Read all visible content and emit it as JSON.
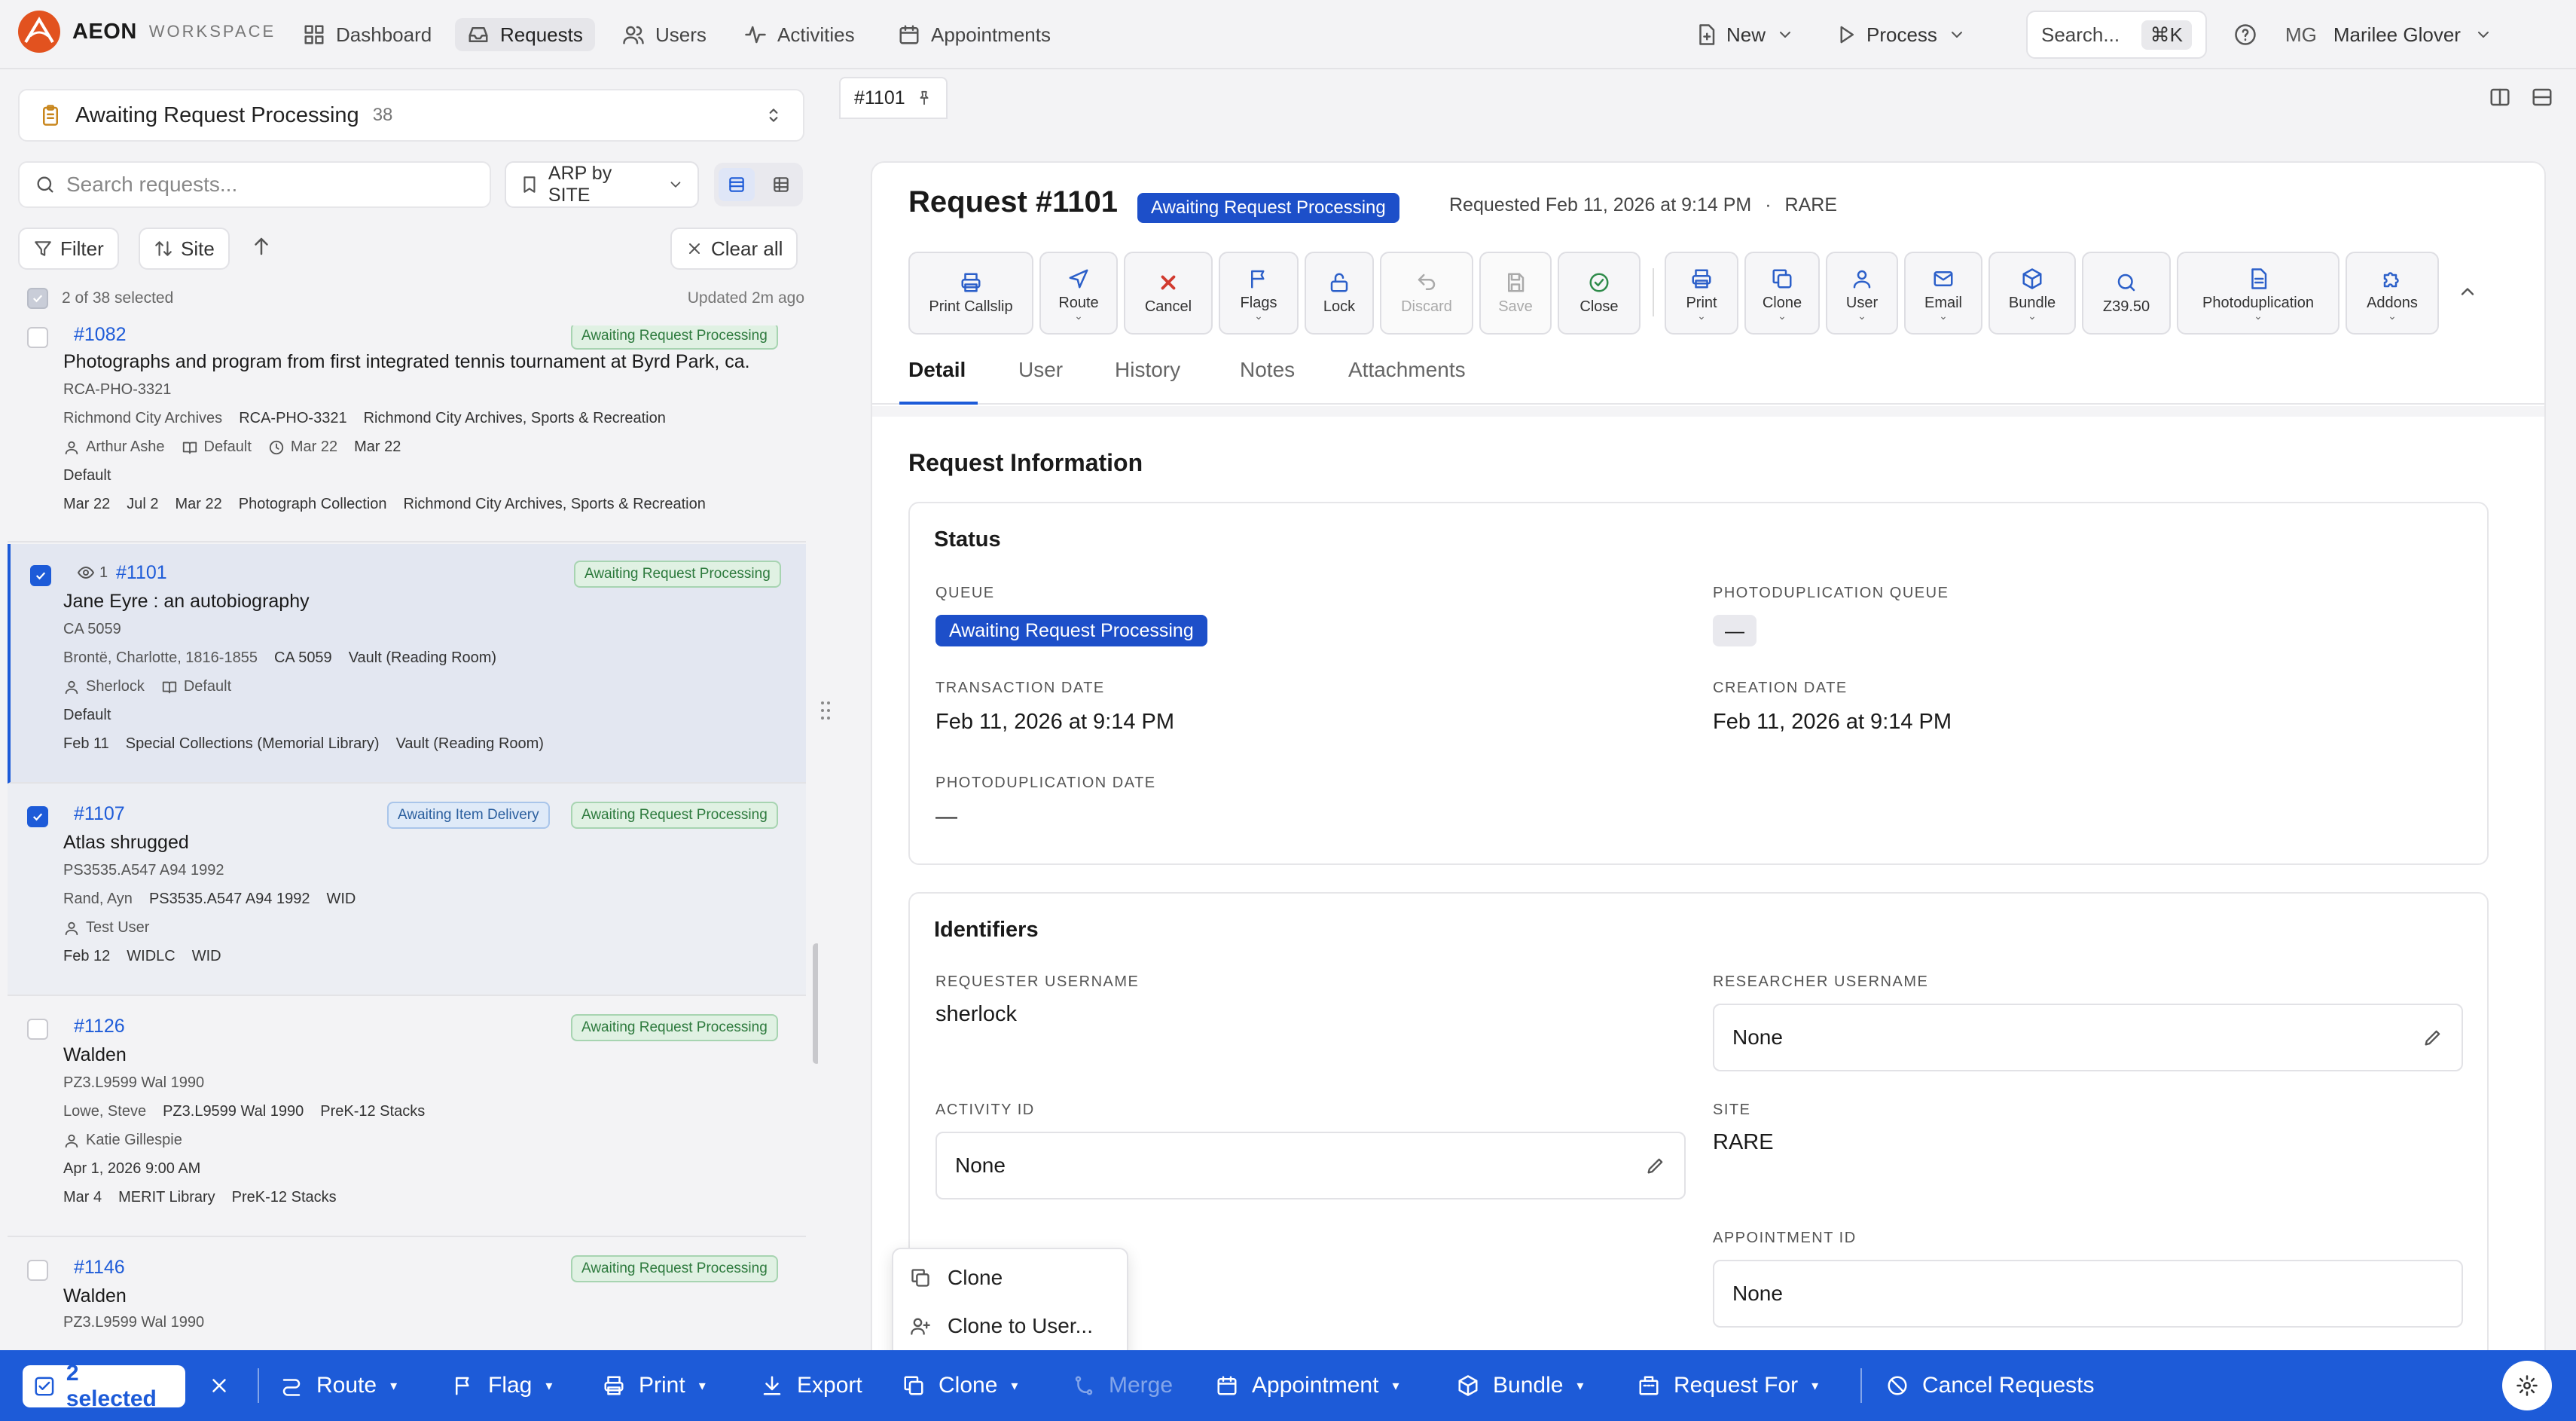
{
  "app": {
    "name": "AEON",
    "sub": "WORKSPACE",
    "accent": "#1d5bd8"
  },
  "nav": [
    {
      "label": "Dashboard",
      "icon": "dashboard-icon"
    },
    {
      "label": "Requests",
      "icon": "inbox-icon"
    },
    {
      "label": "Users",
      "icon": "users-icon"
    },
    {
      "label": "Activities",
      "icon": "activity-icon"
    },
    {
      "label": "Appointments",
      "icon": "calendar-icon"
    }
  ],
  "top": {
    "new": "New",
    "process": "Process",
    "search": "Search...",
    "kbd": "⌘K",
    "initials": "MG",
    "user": "Marilee Glover"
  },
  "left": {
    "queue": "Awaiting Request Processing",
    "queue_count": "38",
    "search_placeholder": "Search requests...",
    "saved": "ARP by SITE",
    "filter": "Filter",
    "sort": "Site",
    "clear": "Clear all",
    "selected": "2 of 38 selected",
    "updated": "Updated 2m ago"
  },
  "cards": [
    {
      "id": "#1082",
      "badges": [
        "Awaiting Request Processing"
      ],
      "title": "Photographs and program from first integrated tennis tournament at Byrd Park, ca.",
      "l1": "RCA-PHO-3321",
      "l2": [
        "Richmond City Archives",
        "RCA-PHO-3321",
        "Richmond City Archives, Sports & Recreation"
      ],
      "user": "Arthur Ashe",
      "book": "Default",
      "clock": "Mar 22",
      "extra": "Mar 22",
      "l4": "Default",
      "l5": [
        "Mar 22",
        "Jul 2",
        "Mar 22",
        "Photograph Collection",
        "Richmond City Archives, Sports & Recreation"
      ]
    },
    {
      "id": "#1101",
      "views": "1",
      "badges": [
        "Awaiting Request Processing"
      ],
      "title": "Jane Eyre : an autobiography",
      "l1": "CA 5059",
      "l2": [
        "Brontë, Charlotte, 1816-1855",
        "CA 5059",
        "Vault (Reading Room)"
      ],
      "user": "Sherlock",
      "book": "Default",
      "l4": "Default",
      "l5": [
        "Feb 11",
        "Special Collections (Memorial Library)",
        "Vault (Reading Room)"
      ]
    },
    {
      "id": "#1107",
      "badges": [
        "Awaiting Item Delivery",
        "Awaiting Request Processing"
      ],
      "title": "Atlas shrugged",
      "l1": "PS3535.A547 A94 1992",
      "l2": [
        "Rand, Ayn",
        "PS3535.A547 A94 1992",
        "WID"
      ],
      "user": "Test User",
      "l5": [
        "Feb 12",
        "WIDLC",
        "WID"
      ]
    },
    {
      "id": "#1126",
      "badges": [
        "Awaiting Request Processing"
      ],
      "title": "Walden",
      "l1": "PZ3.L9599 Wal 1990",
      "l2": [
        "Lowe, Steve",
        "PZ3.L9599 Wal 1990",
        "PreK-12 Stacks"
      ],
      "user": "Katie Gillespie",
      "l4": "Apr 1, 2026 9:00 AM",
      "l5": [
        "Mar 4",
        "MERIT Library",
        "PreK-12 Stacks"
      ]
    },
    {
      "id": "#1146",
      "badges": [
        "Awaiting Request Processing"
      ],
      "title": "Walden",
      "l1": "PZ3.L9599 Wal 1990"
    }
  ],
  "detail": {
    "tab": "#1101",
    "title": "Request #1101",
    "status": "Awaiting Request Processing",
    "meta": "Requested Feb 11, 2026 at 9:14 PM",
    "dot": "·",
    "site_meta": "RARE",
    "toolbar": [
      "Print Callslip",
      "Route",
      "Cancel",
      "Flags",
      "Lock",
      "Discard",
      "Save",
      "Close",
      "Print",
      "Clone",
      "User",
      "Email",
      "Bundle",
      "Z39.50",
      "Photoduplication",
      "Addons"
    ],
    "tabs": [
      "Detail",
      "User",
      "History",
      "Notes",
      "Attachments"
    ],
    "section": "Request Information",
    "status_box": {
      "heading": "Status",
      "queue_label": "QUEUE",
      "queue": "Awaiting Request Processing",
      "photo_queue_label": "PHOTODUPLICATION QUEUE",
      "photo_queue": "—",
      "tdate_label": "TRANSACTION DATE",
      "tdate": "Feb 11, 2026 at 9:14 PM",
      "cdate_label": "CREATION DATE",
      "cdate": "Feb 11, 2026 at 9:14 PM",
      "pdate_label": "PHOTODUPLICATION DATE",
      "pdate": "—"
    },
    "ident": {
      "heading": "Identifiers",
      "req_label": "REQUESTER USERNAME",
      "req": "sherlock",
      "res_label": "RESEARCHER USERNAME",
      "res": "None",
      "act_label": "ACTIVITY ID",
      "act": "None",
      "site_label": "SITE",
      "site": "RARE",
      "appt_label": "APPOINTMENT ID",
      "appt": "None"
    }
  },
  "popup": [
    "Clone",
    "Clone to User..."
  ],
  "bottom": {
    "selected": "2 selected",
    "actions": [
      "Route",
      "Flag",
      "Print",
      "Export",
      "Clone",
      "Merge",
      "Appointment",
      "Bundle",
      "Request For",
      "Cancel Requests"
    ]
  }
}
